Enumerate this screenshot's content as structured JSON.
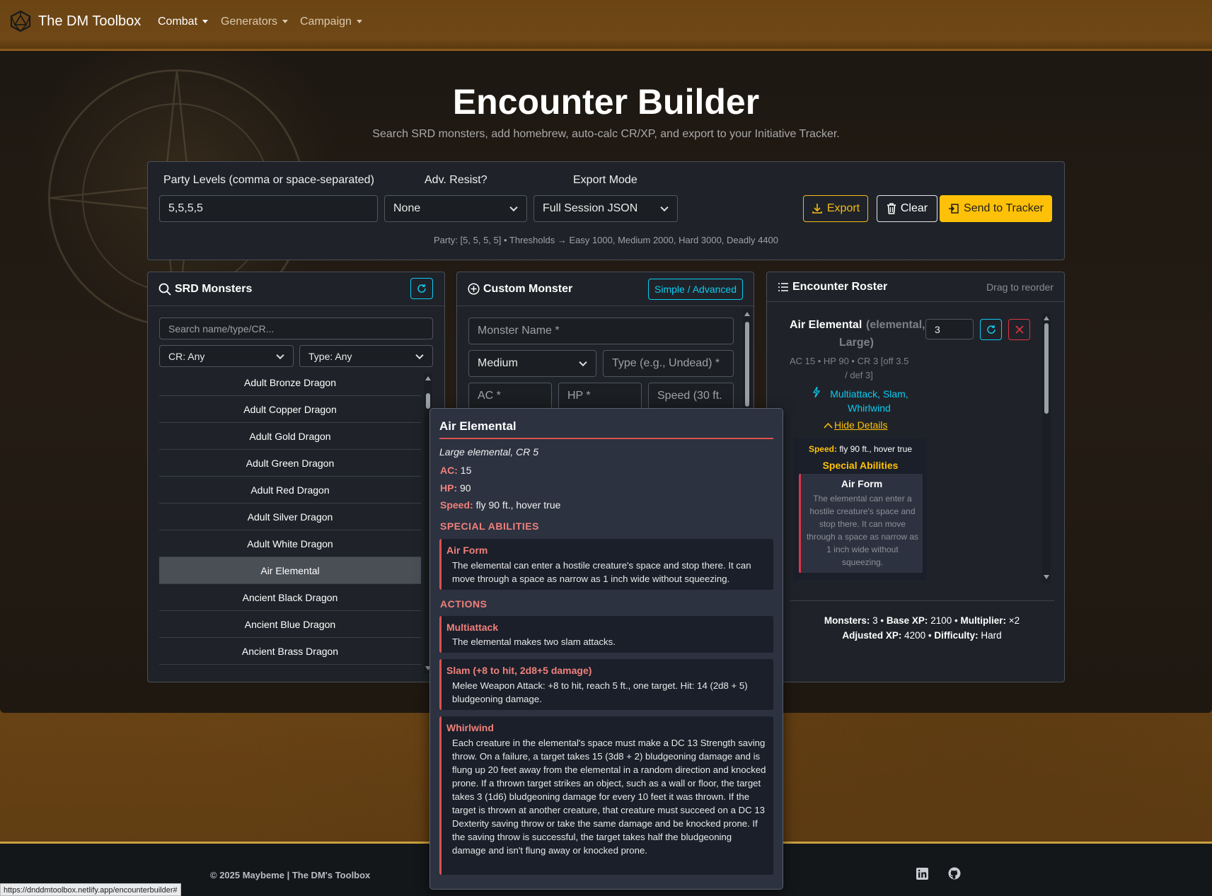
{
  "navbar": {
    "brand": "The DM Toolbox",
    "items": [
      {
        "label": "Combat",
        "active": true
      },
      {
        "label": "Generators",
        "active": false
      },
      {
        "label": "Campaign",
        "active": false
      }
    ]
  },
  "hero": {
    "title": "Encounter Builder",
    "subtitle": "Search SRD monsters, add homebrew, auto-calc CR/XP, and export to your Initiative Tracker."
  },
  "controls": {
    "party_label": "Party Levels (comma or space-separated)",
    "party_value": "5,5,5,5",
    "resist_label": "Adv. Resist?",
    "resist_value": "None",
    "export_label": "Export Mode",
    "export_value": "Full Session JSON",
    "export_btn": "Export",
    "clear_btn": "Clear",
    "send_btn": "Send to Tracker",
    "party_info": "Party: [5, 5, 5, 5] • Thresholds → Easy 1000, Medium 2000, Hard 3000, Deadly 4400"
  },
  "srd": {
    "title": "SRD Monsters",
    "search_placeholder": "Search name/type/CR...",
    "cr_filter": "CR: Any",
    "type_filter": "Type: Any",
    "monsters": [
      "Adult Bronze Dragon",
      "Adult Copper Dragon",
      "Adult Gold Dragon",
      "Adult Green Dragon",
      "Adult Red Dragon",
      "Adult Silver Dragon",
      "Adult White Dragon",
      "Air Elemental",
      "Ancient Black Dragon",
      "Ancient Blue Dragon",
      "Ancient Brass Dragon"
    ],
    "selected_index": 7
  },
  "custom": {
    "title": "Custom Monster",
    "mode_btn": "Simple / Advanced",
    "name_placeholder": "Monster Name *",
    "size_value": "Medium",
    "type_placeholder": "Type (e.g., Undead) *",
    "ac_placeholder": "AC *",
    "hp_placeholder": "HP *",
    "speed_placeholder": "Speed (30 ft."
  },
  "roster": {
    "title": "Encounter Roster",
    "hint": "Drag to reorder",
    "entry": {
      "name": "Air Elemental",
      "meta_line1": "(elemental,",
      "meta_line2": "Large)",
      "qty": "3",
      "stats_line1": "AC 15 • HP 90 • CR 3   [off 3.5",
      "stats_line2": "/ def 3]",
      "actions_line1": "Multiattack, Slam,",
      "actions_line2": "Whirlwind",
      "toggle": "Hide Details",
      "speed_key": "Speed:",
      "speed_val": "fly 90 ft., hover true",
      "special_heading": "Special Abilities",
      "ability_name": "Air Form",
      "ability_text": "The elemental can enter a hostile creature's space and stop there. It can move through a space as narrow as 1 inch wide without squeezing."
    },
    "summary": {
      "monsters_key": "Monsters:",
      "monsters_val": "3",
      "base_key": "Base XP:",
      "base_val": "2100",
      "mult_key": "Multiplier:",
      "mult_val": "×2",
      "adj_key": "Adjusted XP:",
      "adj_val": "4200",
      "diff_key": "Difficulty:",
      "diff_val": "Hard"
    }
  },
  "popover": {
    "name": "Air Elemental",
    "subtitle": "Large elemental, CR 5",
    "ac_key": "AC:",
    "ac_val": "15",
    "hp_key": "HP:",
    "hp_val": "90",
    "speed_key": "Speed:",
    "speed_val": "fly 90 ft., hover true",
    "special_heading": "SPECIAL ABILITIES",
    "special": [
      {
        "name": "Air Form",
        "desc": "The elemental can enter a hostile creature's space and stop there. It can move through a space as narrow as 1 inch wide without squeezing."
      }
    ],
    "actions_heading": "ACTIONS",
    "actions": [
      {
        "name": "Multiattack",
        "desc": "The elemental makes two slam attacks."
      },
      {
        "name": "Slam (+8 to hit, 2d8+5 damage)",
        "desc": "Melee Weapon Attack: +8 to hit, reach 5 ft., one target. Hit: 14 (2d8 + 5) bludgeoning damage."
      },
      {
        "name": "Whirlwind",
        "desc": "Each creature in the elemental's space must make a DC 13 Strength saving throw. On a failure, a target takes 15 (3d8 + 2) bludgeoning damage and is flung up 20 feet away from the elemental in a random direction and knocked prone. If a thrown target strikes an object, such as a wall or floor, the target takes 3 (1d6) bludgeoning damage for every 10 feet it was thrown. If the target is thrown at another creature, that creature must succeed on a DC 13 Dexterity saving throw or take the same damage and be knocked prone. If the saving throw is successful, the target takes half the bludgeoning damage and isn't flung away or knocked prone."
      }
    ]
  },
  "footer": {
    "copyright": "© 2025 Maybeme | The DM's Toolbox"
  },
  "status_url": "https://dnddmtoolbox.netlify.app/encounterbuilder#",
  "colors": {
    "accent": "#ffc107",
    "info": "#0dcaf0",
    "danger": "#dc3545",
    "stat_key": "#f0807a"
  },
  "icons": [
    "d20-icon",
    "search-icon",
    "refresh-icon",
    "plus-circle-icon",
    "list-icon",
    "download-icon",
    "trash-icon",
    "send-icon",
    "lightning-icon",
    "chevron-up-icon",
    "close-icon",
    "linkedin-icon",
    "github-icon"
  ]
}
